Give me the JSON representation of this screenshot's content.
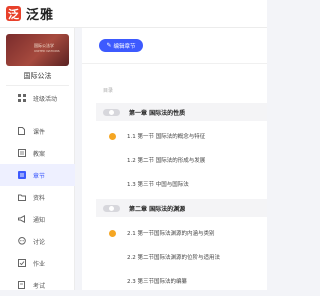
{
  "app": {
    "logo_char": "泛",
    "brand": "泛雅"
  },
  "course": {
    "cover_title": "国际公法学",
    "cover_subtitle": "UNITED NATIONS",
    "name": "国际公法"
  },
  "sidebar": {
    "items": [
      {
        "label": "班级活动",
        "icon": "grid-icon"
      },
      {
        "label": "课件",
        "icon": "file-icon"
      },
      {
        "label": "教案",
        "icon": "book-icon"
      },
      {
        "label": "章节",
        "icon": "chapter-icon"
      },
      {
        "label": "资料",
        "icon": "folder-icon"
      },
      {
        "label": "通知",
        "icon": "megaphone-icon"
      },
      {
        "label": "讨论",
        "icon": "chat-icon"
      },
      {
        "label": "作业",
        "icon": "homework-icon"
      },
      {
        "label": "考试",
        "icon": "exam-icon"
      }
    ],
    "active_index": 3,
    "accent_color": "#3d5afe"
  },
  "main": {
    "edit_button_label": "编辑章节",
    "toc_label": "目录",
    "chapters": [
      {
        "title": "第一章 国际法的性质",
        "sections": [
          {
            "title": "1.1 第一节 国际法的概念与特征",
            "marked": true
          },
          {
            "title": "1.2 第二节 国际法的形成与发展",
            "marked": false
          },
          {
            "title": "1.3 第三节 中国与国际法",
            "marked": false
          }
        ]
      },
      {
        "title": "第二章 国际法的渊源",
        "sections": [
          {
            "title": "2.1 第一节国际法渊源的内涵与类别",
            "marked": true
          },
          {
            "title": "2.2 第二节国际法渊源的位阶与适用法",
            "marked": false
          },
          {
            "title": "2.3 第三节国际法的编纂",
            "marked": false
          }
        ]
      }
    ],
    "marker_color": "#f5a623"
  }
}
